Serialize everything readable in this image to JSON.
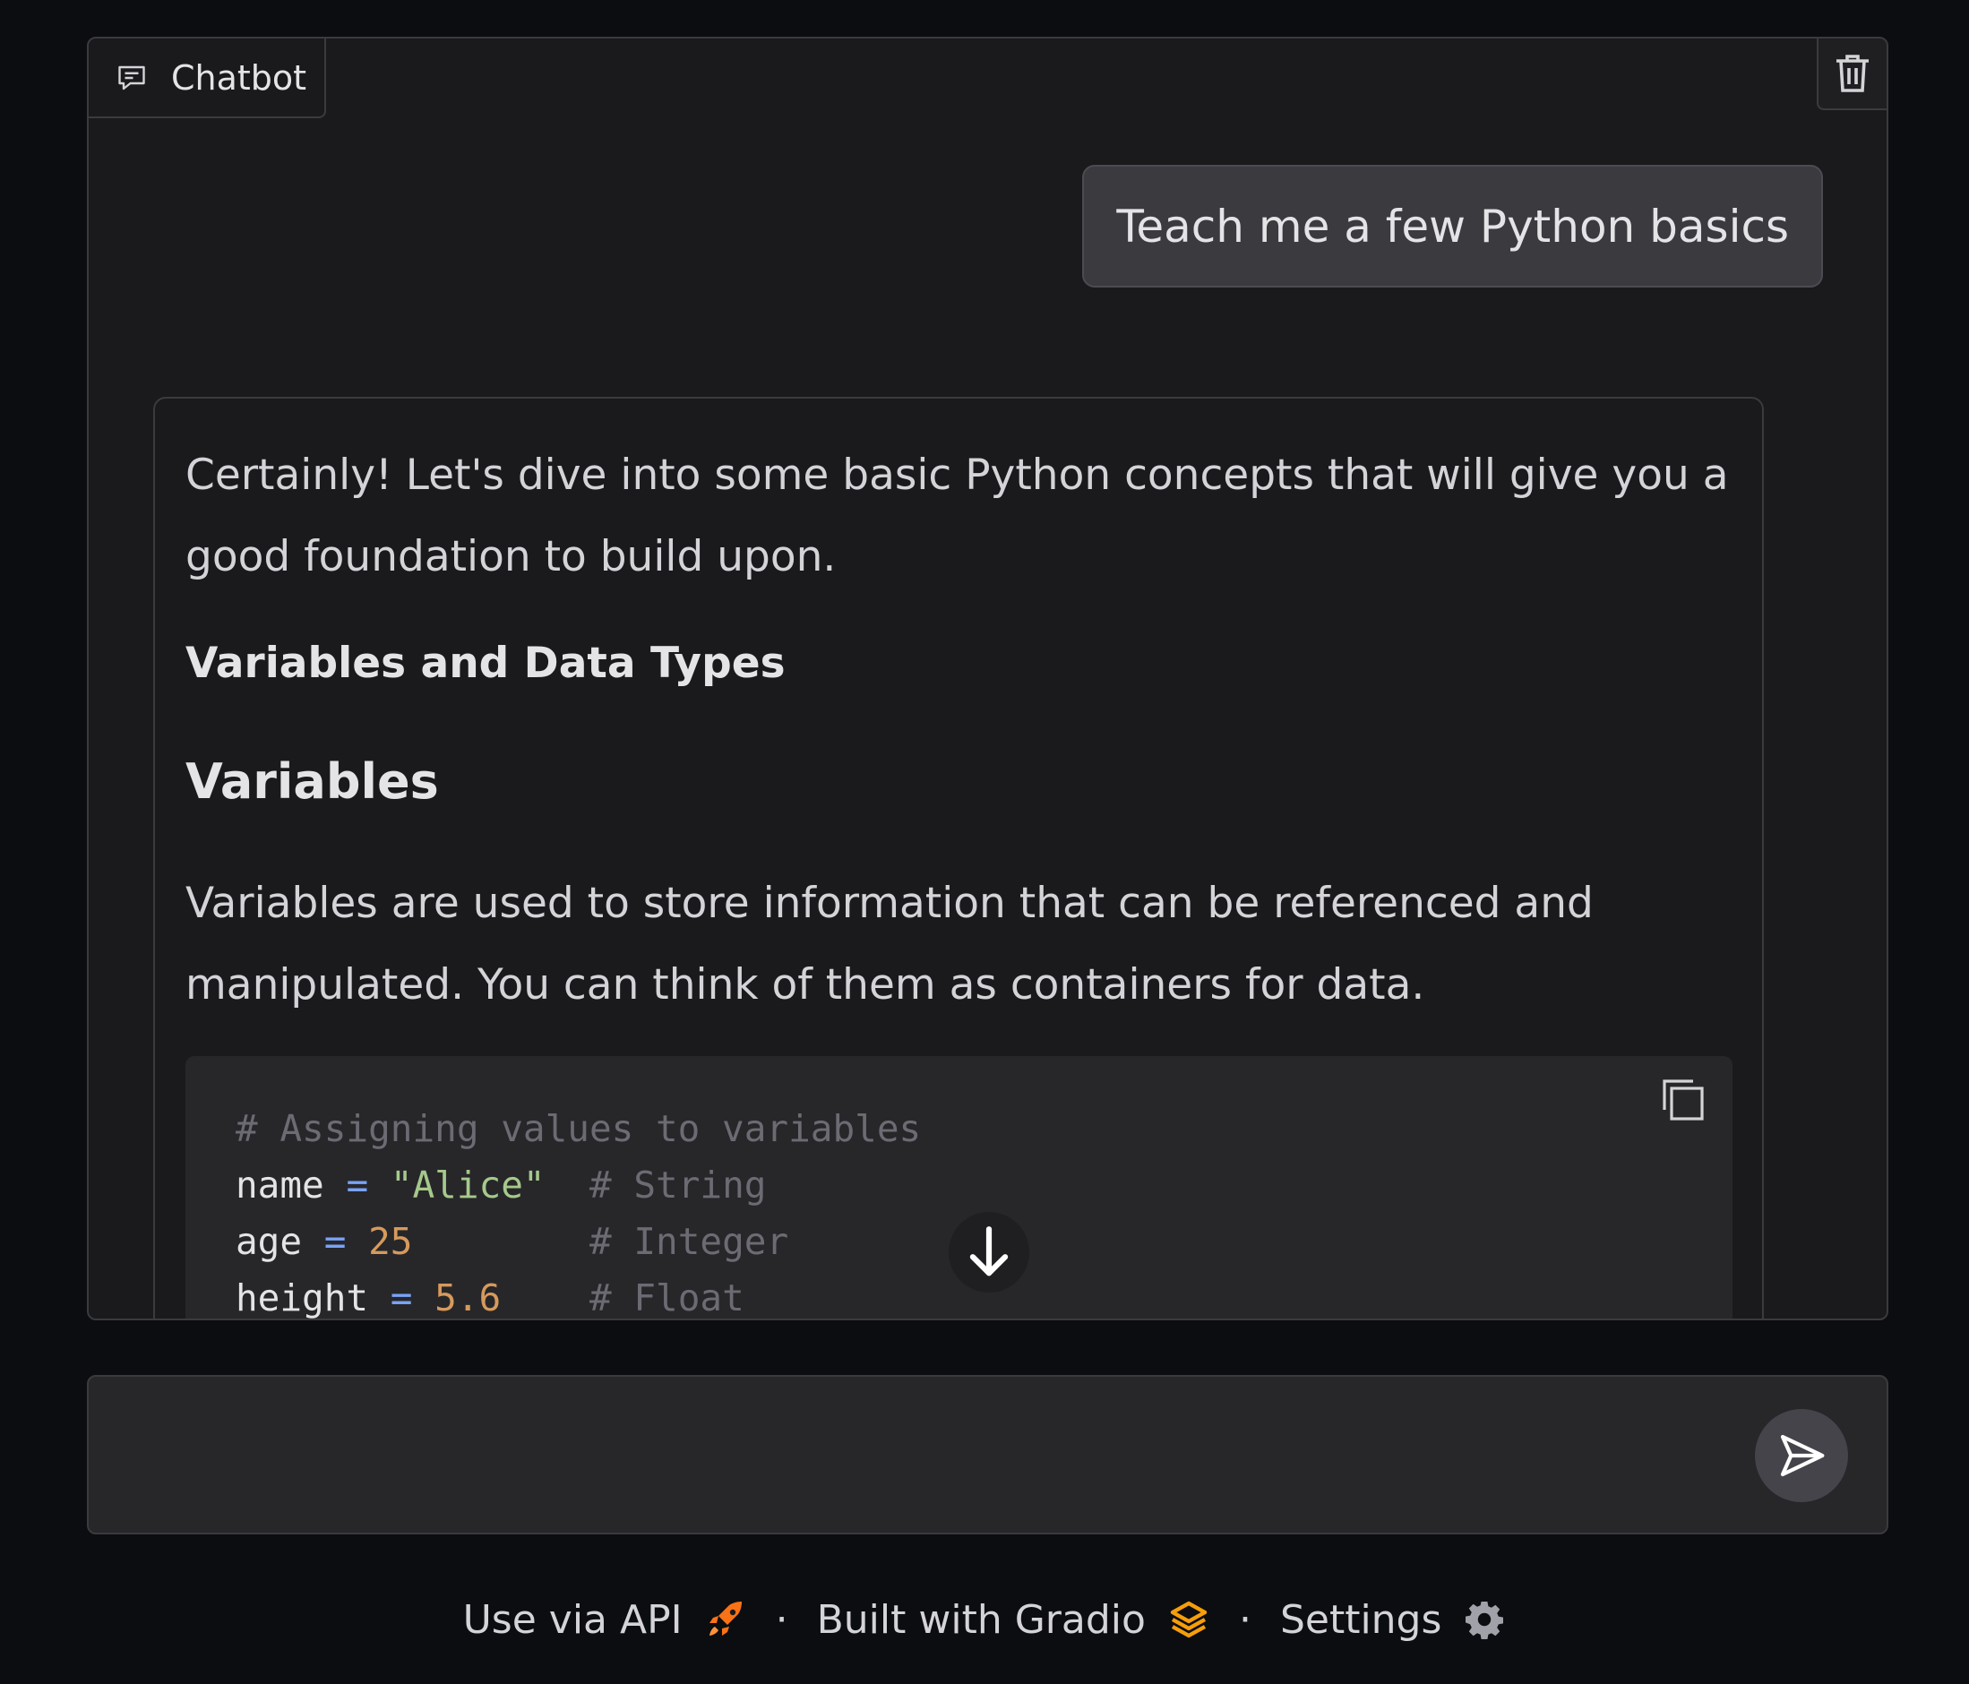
{
  "chatbot": {
    "label": "Chatbot",
    "clear_icon": "trash-icon",
    "user_message": "Teach me a few Python basics",
    "bot_message": {
      "intro": "Certainly! Let's dive into some basic Python concepts that will give you a good foundation to build upon.",
      "heading_strong": "Variables and Data Types",
      "heading_variables": "Variables",
      "variables_text": "Variables are used to store information that can be referenced and manipulated. You can think of them as containers for data.",
      "code": {
        "comment_line": "# Assigning values to variables",
        "lines": [
          {
            "name": "name",
            "op": "=",
            "value": "\"Alice\"",
            "pad": "  ",
            "comment": "# String"
          },
          {
            "name": "age",
            "op": "=",
            "value": "25",
            "pad": "        ",
            "comment": "# Integer"
          },
          {
            "name": "height",
            "op": "=",
            "value": "5.6",
            "pad": "    ",
            "comment": "# Float"
          }
        ]
      }
    },
    "scroll_icon": "arrow-down-icon"
  },
  "input": {
    "placeholder": "",
    "value": "",
    "send_icon": "send-icon"
  },
  "footer": {
    "api_label": "Use via API",
    "api_icon": "rocket-icon",
    "separator": "·",
    "built_label": "Built with Gradio",
    "built_icon": "gradio-logo-icon",
    "settings_label": "Settings",
    "settings_icon": "gear-icon"
  },
  "colors": {
    "background": "#0c0d10",
    "panel": "#1a1a1d",
    "user_bubble": "#3a3a3f",
    "code_bg": "#27272a",
    "accent_orange": "#f97316",
    "code_string": "#a6c98b",
    "code_number": "#d69a5c",
    "code_operator": "#7aa2f7"
  }
}
